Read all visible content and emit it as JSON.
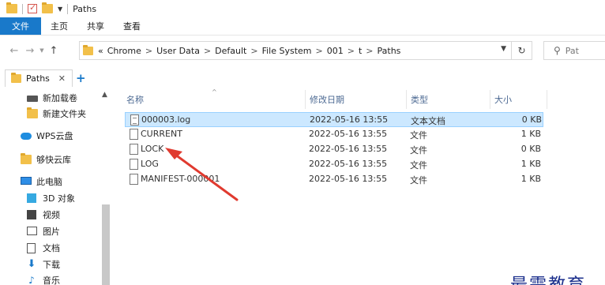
{
  "window": {
    "title": "Paths"
  },
  "ribbon": {
    "tabs": [
      "文件",
      "主页",
      "共享",
      "查看"
    ]
  },
  "address": {
    "crumbs": [
      "«",
      "Chrome",
      "User Data",
      "Default",
      "File System",
      "001",
      "t",
      "Paths"
    ],
    "separator": ">",
    "search_placeholder": "搜索 Paths",
    "search_visible": "Pat"
  },
  "tab": {
    "label": "Paths"
  },
  "sidebar": {
    "items": [
      {
        "label": "新加载卷",
        "icon": "drive-icon"
      },
      {
        "label": "新建文件夹",
        "icon": "folder-icon"
      },
      {
        "label": "WPS云盘",
        "icon": "cloud-icon"
      },
      {
        "label": "够快云库",
        "icon": "folder-icon"
      },
      {
        "label": "此电脑",
        "icon": "computer-icon"
      },
      {
        "label": "3D 对象",
        "icon": "cube-icon"
      },
      {
        "label": "视频",
        "icon": "video-icon"
      },
      {
        "label": "图片",
        "icon": "picture-icon"
      },
      {
        "label": "文档",
        "icon": "document-icon"
      },
      {
        "label": "下载",
        "icon": "download-icon"
      },
      {
        "label": "音乐",
        "icon": "music-icon"
      }
    ]
  },
  "columns": {
    "name": "名称",
    "modified": "修改日期",
    "type": "类型",
    "size": "大小"
  },
  "files": [
    {
      "name": "000003.log",
      "modified": "2022-05-16 13:55",
      "type": "文本文档",
      "size": "0 KB",
      "selected": true
    },
    {
      "name": "CURRENT",
      "modified": "2022-05-16 13:55",
      "type": "文件",
      "size": "1 KB",
      "selected": false
    },
    {
      "name": "LOCK",
      "modified": "2022-05-16 13:55",
      "type": "文件",
      "size": "0 KB",
      "selected": false
    },
    {
      "name": "LOG",
      "modified": "2022-05-16 13:55",
      "type": "文件",
      "size": "1 KB",
      "selected": false
    },
    {
      "name": "MANIFEST-000001",
      "modified": "2022-05-16 13:55",
      "type": "文件",
      "size": "1 KB",
      "selected": false
    }
  ],
  "annotation": {
    "arrow_color": "#e03a2f"
  },
  "watermark": {
    "text": "最需教育"
  },
  "colors": {
    "accent": "#1979ca",
    "selection": "#cce8ff",
    "header_text": "#4d6a93"
  }
}
